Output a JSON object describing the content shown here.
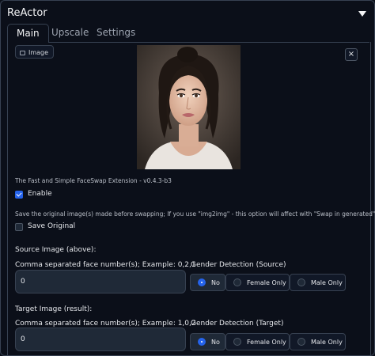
{
  "panel": {
    "title": "ReActor"
  },
  "tabs": [
    {
      "label": "Main"
    },
    {
      "label": "Upscale"
    },
    {
      "label": "Settings"
    }
  ],
  "image_block": {
    "label": "Image",
    "close_glyph": "×"
  },
  "description": "The Fast and Simple FaceSwap Extension - v0.4.3-b3",
  "enable": {
    "label": "Enable",
    "checked": true
  },
  "save_hint": "Save the original image(s) made before swapping; If you use \"img2img\" - this option will affect with \"Swap in generated\" only",
  "save_original": {
    "label": "Save Original",
    "checked": false
  },
  "source": {
    "section_label": "Source Image (above):",
    "faces_label": "Comma separated face number(s); Example: 0,2,1",
    "faces_value": "0",
    "gender_label": "Gender Detection (Source)",
    "gender_options": [
      "No",
      "Female Only",
      "Male Only"
    ],
    "gender_selected": "No"
  },
  "target": {
    "section_label": "Target Image (result):",
    "faces_label": "Comma separated face number(s); Example: 1,0,2",
    "faces_value": "0",
    "gender_label": "Gender Detection (Target)",
    "gender_options": [
      "No",
      "Female Only",
      "Male Only"
    ],
    "gender_selected": "No"
  },
  "colors": {
    "accent": "#2563eb",
    "background": "#0b0f19",
    "border": "#374151"
  }
}
